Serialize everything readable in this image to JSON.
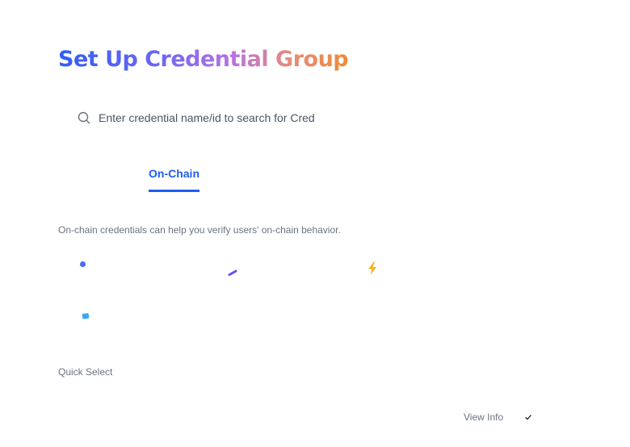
{
  "header": {
    "title": "Set Up Credential Group"
  },
  "search": {
    "placeholder": "Enter credential name/id to search for Cred",
    "value": ""
  },
  "tabs": [
    {
      "label": "On-Chain",
      "active": true
    }
  ],
  "description": "On-chain credentials can help you verify users' on-chain behavior.",
  "credential_icons": [
    {
      "name": "blue-dot-icon",
      "color": "#4a6cf7"
    },
    {
      "name": "purple-slash-icon",
      "color": "#6a4cf0"
    },
    {
      "name": "lightning-icon",
      "color": "#f5b21b"
    },
    {
      "name": "blue-card-icon",
      "color": "#3aa5f5"
    }
  ],
  "quick_select": {
    "label": "Quick Select"
  },
  "view_info": {
    "label": "View Info"
  },
  "colors": {
    "accent": "#1d5ef0",
    "muted_text": "#6b7280",
    "title_gradient": [
      "#2f5ef7",
      "#b673e0",
      "#f08a37"
    ]
  }
}
